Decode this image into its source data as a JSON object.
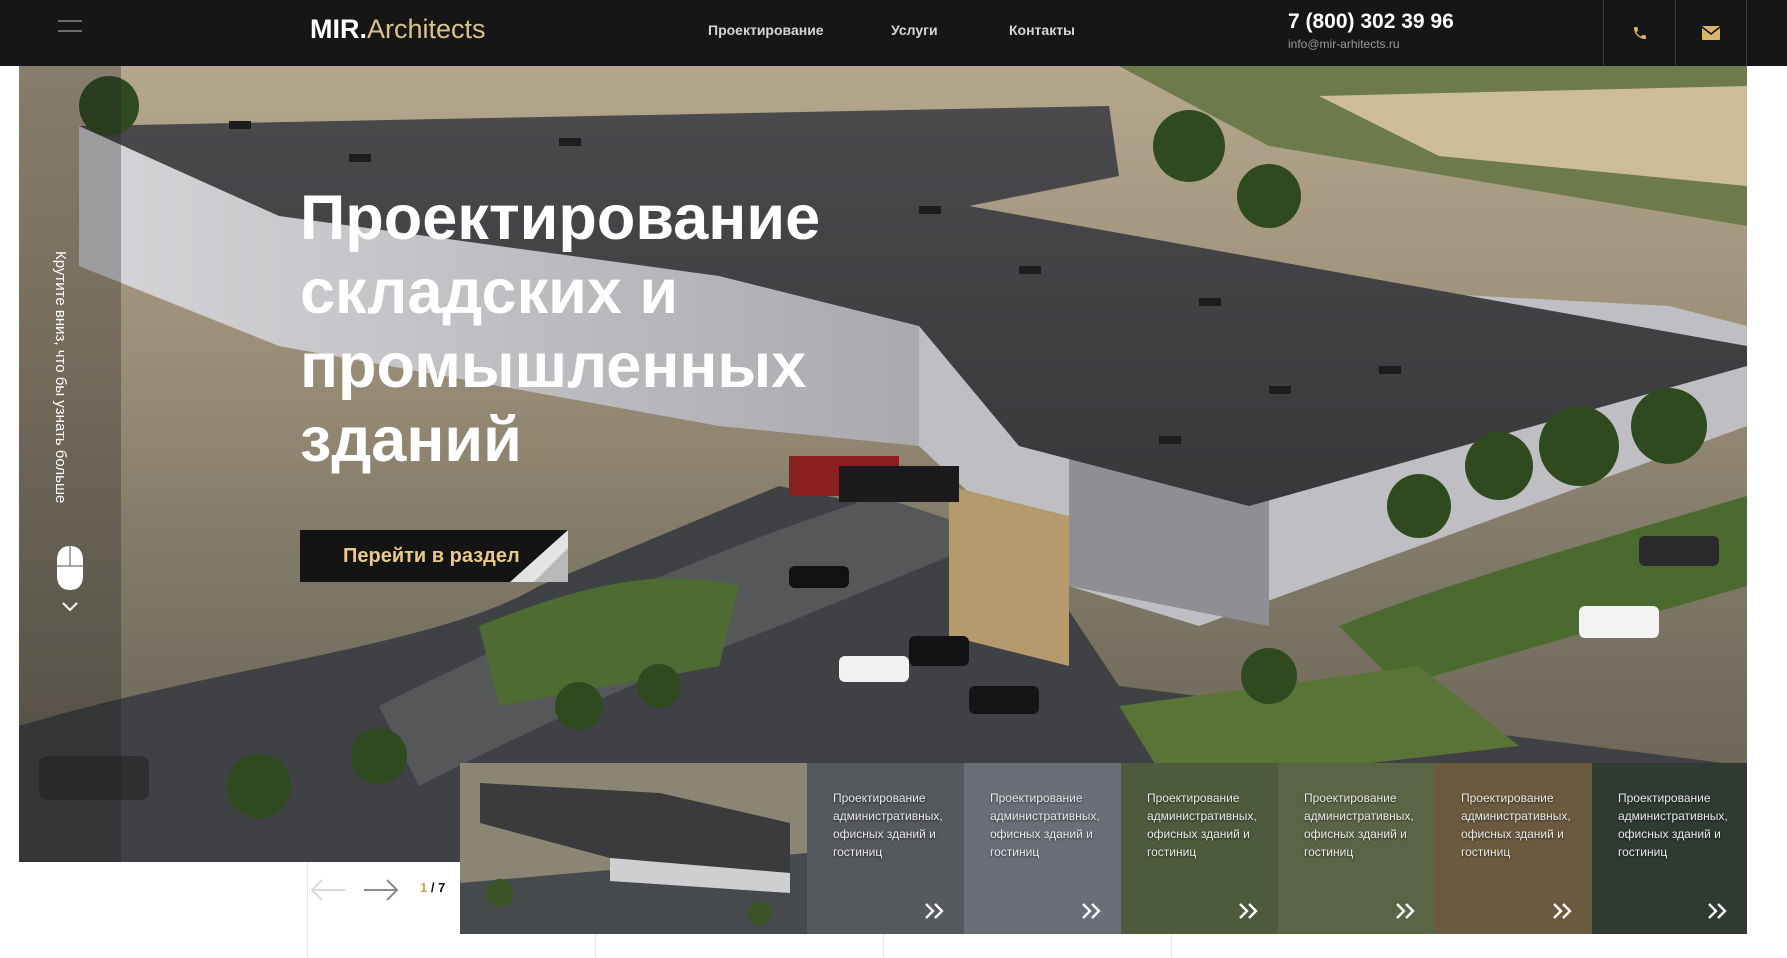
{
  "header": {
    "logo_main": "MIR.",
    "logo_accent": "Architects",
    "nav": [
      "Проектирование",
      "Услуги",
      "Контакты"
    ],
    "phone": "7 (800) 302 39 96",
    "email": "info@mir-arhitects.ru"
  },
  "hero": {
    "title_lines": [
      "Проектирование",
      "складских и",
      "промышленных",
      "зданий"
    ],
    "cta_label": "Перейти в раздел",
    "scroll_hint": "Крутите вниз, что бы узнать больше"
  },
  "slider": {
    "current": "1",
    "separator": " / ",
    "total": "7",
    "thumb_caption": "Проектирование административных, офисных зданий и гостиниц"
  },
  "colors": {
    "header_bg": "#161616",
    "accent_gold": "#d9c28c",
    "cta_text": "#e8c98a"
  },
  "icons": [
    "menu-icon",
    "phone-icon",
    "mail-icon",
    "mouse-icon",
    "chevron-down-icon",
    "arrow-left-icon",
    "arrow-right-icon",
    "double-chevron-right-icon"
  ]
}
